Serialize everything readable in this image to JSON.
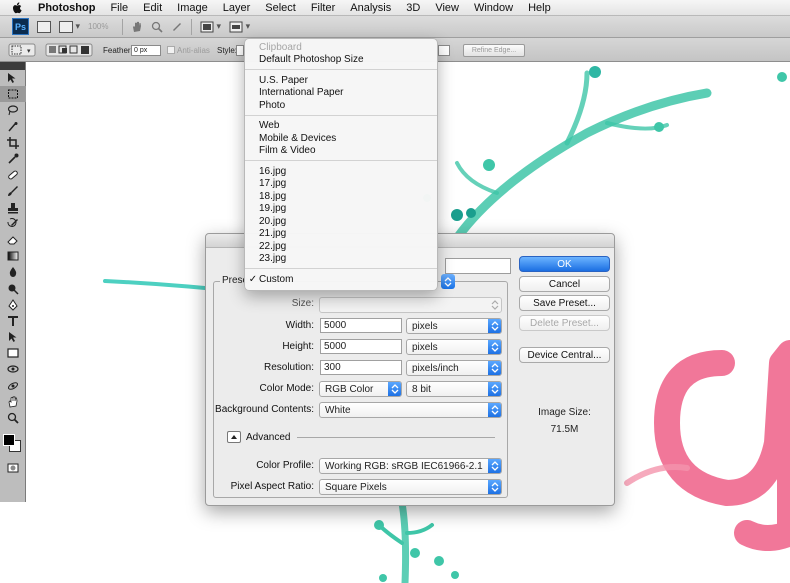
{
  "menubar": {
    "app_name": "Photoshop",
    "menus": [
      "File",
      "Edit",
      "Image",
      "Layer",
      "Select",
      "Filter",
      "Analysis",
      "3D",
      "View",
      "Window",
      "Help"
    ]
  },
  "appbar": {
    "logo": "Ps",
    "zoom": "100%"
  },
  "optionsbar": {
    "feather_label": "Feather:",
    "feather_value": "0 px",
    "anti_alias_label": "Anti-alias",
    "style_label": "Style:",
    "refine_edge_label": "Refine Edge..."
  },
  "tools": [
    "move-tool",
    "marquee-tool",
    "lasso-tool",
    "quick-select-tool",
    "crop-tool",
    "eyedropper-tool",
    "healing-brush-tool",
    "brush-tool",
    "clone-stamp-tool",
    "history-brush-tool",
    "eraser-tool",
    "gradient-tool",
    "blur-tool",
    "dodge-tool",
    "pen-tool",
    "type-tool",
    "path-select-tool",
    "shape-tool",
    "3d-rotate-tool",
    "3d-orbit-tool",
    "hand-tool",
    "zoom-tool"
  ],
  "dialog": {
    "preset_label": "Prese",
    "size_label": "Size:",
    "width_label": "Width:",
    "width_value": "5000",
    "width_unit": "pixels",
    "height_label": "Height:",
    "height_value": "5000",
    "height_unit": "pixels",
    "resolution_label": "Resolution:",
    "resolution_value": "300",
    "resolution_unit": "pixels/inch",
    "color_mode_label": "Color Mode:",
    "color_mode_value": "RGB Color",
    "bit_depth_value": "8 bit",
    "background_label": "Background Contents:",
    "background_value": "White",
    "advanced_label": "Advanced",
    "color_profile_label": "Color Profile:",
    "color_profile_value": "Working RGB:  sRGB IEC61966-2.1",
    "pixel_aspect_label": "Pixel Aspect Ratio:",
    "pixel_aspect_value": "Square Pixels",
    "buttons": {
      "ok": "OK",
      "cancel": "Cancel",
      "save_preset": "Save Preset...",
      "delete_preset": "Delete Preset...",
      "device_central": "Device Central..."
    },
    "image_size_label": "Image Size:",
    "image_size_value": "71.5M"
  },
  "preset_menu": {
    "groups": [
      [
        {
          "label": "Clipboard",
          "disabled": true
        },
        {
          "label": "Default Photoshop Size"
        }
      ],
      [
        {
          "label": "U.S. Paper"
        },
        {
          "label": "International Paper"
        },
        {
          "label": "Photo"
        }
      ],
      [
        {
          "label": "Web"
        },
        {
          "label": "Mobile & Devices"
        },
        {
          "label": "Film & Video"
        }
      ],
      [
        {
          "label": "16.jpg"
        },
        {
          "label": "17.jpg"
        },
        {
          "label": "18.jpg"
        },
        {
          "label": "19.jpg"
        },
        {
          "label": "20.jpg"
        },
        {
          "label": "21.jpg"
        },
        {
          "label": "22.jpg"
        },
        {
          "label": "23.jpg"
        }
      ],
      [
        {
          "label": "Custom",
          "checked": true
        }
      ]
    ],
    "check_mark": "✓"
  },
  "colors": {
    "accent_blue": "#1b6fe2",
    "teal": "#3fc6a8",
    "pink": "#ec4d7a",
    "arrow": "#4dd0c1"
  }
}
